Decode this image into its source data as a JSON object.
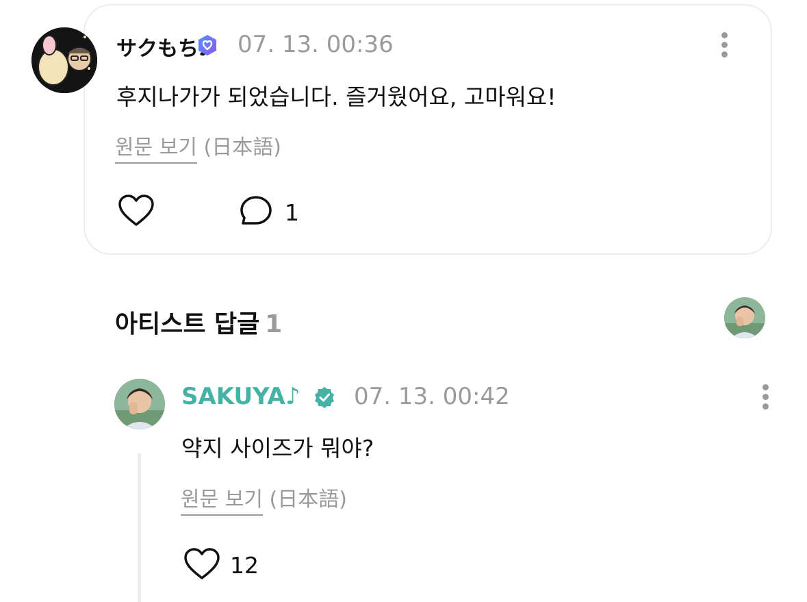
{
  "comment": {
    "author": "サクもち♪",
    "timestamp": "07. 13. 00:36",
    "body": "후지나가가 되었습니다. 즐거웠어요, 고마워요!",
    "view_original_link": "원문 보기",
    "view_original_lang": "(日本語)",
    "reply_count": "1",
    "badge_color": "#6b7cf5"
  },
  "artist_section": {
    "title": "아티스트 답글",
    "count": "1"
  },
  "artist_reply": {
    "author": "SAKUYA♪",
    "timestamp": "07. 13. 00:42",
    "body": "약지 사이즈가 뭐야?",
    "view_original_link": "원문 보기",
    "view_original_lang": "(日本語)",
    "like_count": "12",
    "name_color": "#46b2a6",
    "badge_color": "#46b2a6"
  }
}
